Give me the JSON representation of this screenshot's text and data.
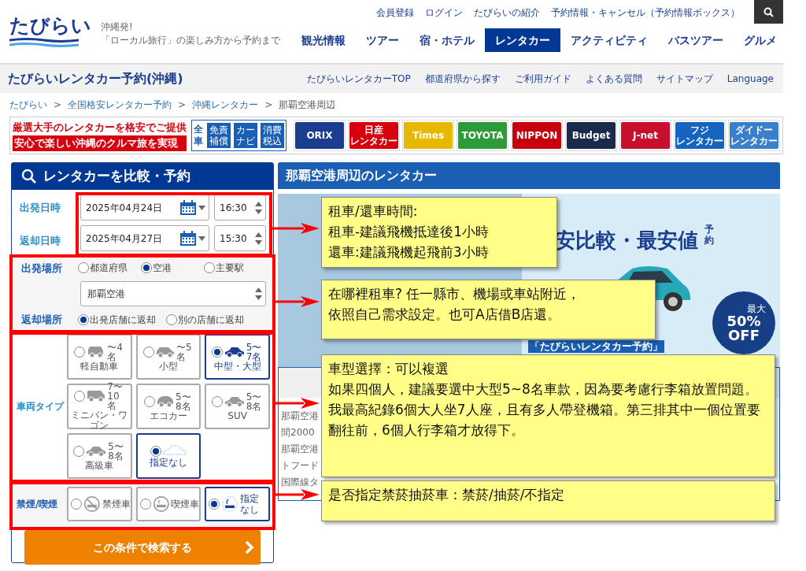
{
  "header": {
    "logo": "たびらい",
    "tagline_1": "沖縄発!",
    "tagline_2": "「ローカル旅行」の楽しみ方から予約まで",
    "top_links": [
      "会員登録",
      "ログイン",
      "たびらいの紹介",
      "予約情報・キャンセル（予約情報ボックス）"
    ],
    "nav": [
      {
        "label": "観光情報",
        "selected": false
      },
      {
        "label": "ツアー",
        "selected": false
      },
      {
        "label": "宿・ホテル",
        "selected": false
      },
      {
        "label": "レンタカー",
        "selected": true
      },
      {
        "label": "アクティビティ",
        "selected": false
      },
      {
        "label": "バスツアー",
        "selected": false
      },
      {
        "label": "グルメ",
        "selected": false
      }
    ]
  },
  "subheader": {
    "title": "たびらいレンタカー予約(沖縄)",
    "links": [
      "たびらいレンタカーTOP",
      "都道府県から探す",
      "ご利用ガイド",
      "よくある質問",
      "サイトマップ",
      "Language"
    ]
  },
  "breadcrumb": {
    "separator": ">",
    "items": [
      "たびらい",
      "全国格安レンタカー予約",
      "沖縄レンタカー",
      "那覇空港周辺"
    ]
  },
  "banner": {
    "line_1": "厳選大手のレンタカーを格安でご提供",
    "line_2": "安心で楽しい沖縄のクルマ旅を実現",
    "all_cars": "全車",
    "features": [
      "免責補償",
      "カーナビ",
      "消費税込"
    ],
    "logos": [
      {
        "lines": [
          "ORIX"
        ],
        "color": "#1a3d8f"
      },
      {
        "lines": [
          "日産",
          "レンタカー"
        ],
        "color": "#d7000f"
      },
      {
        "lines": [
          "Times"
        ],
        "color": "#e6b800"
      },
      {
        "lines": [
          "TOYOTA"
        ],
        "color": "#2e9a3a"
      },
      {
        "lines": [
          "NIPPON"
        ],
        "color": "#c8000d"
      },
      {
        "lines": [
          "Budget"
        ],
        "color": "#1b2a4a"
      },
      {
        "lines": [
          "J-net"
        ],
        "color": "#c8102e"
      },
      {
        "lines": [
          "フジ",
          "レンタカー"
        ],
        "color": "#1565c0"
      },
      {
        "lines": [
          "ダイドー",
          "レンタカー"
        ],
        "color": "#3a7fc9"
      }
    ]
  },
  "search_panel": {
    "title": "レンタカーを比較・予約",
    "pickup": {
      "label": "出発日時",
      "date": "2025年04月24日",
      "time": "16:30"
    },
    "return": {
      "label": "返却日時",
      "date": "2025年04月27日",
      "time": "15:30"
    },
    "departure_place": {
      "label": "出発場所",
      "options": [
        {
          "label": "都道府県",
          "selected": false
        },
        {
          "label": "空港",
          "selected": true
        },
        {
          "label": "主要駅",
          "selected": false
        }
      ],
      "value": "那覇空港"
    },
    "return_place": {
      "label": "返却場所",
      "options": [
        {
          "label": "出発店舗に返却",
          "selected": true
        },
        {
          "label": "別の店舗に返却",
          "selected": false
        }
      ]
    },
    "vehicle": {
      "label": "車両タイプ",
      "options": [
        {
          "kind": "suv",
          "label": "軽自動車",
          "capacity": "〜4名",
          "selected": false
        },
        {
          "kind": "compact",
          "label": "小型",
          "capacity": "〜5名",
          "selected": false
        },
        {
          "kind": "sedan",
          "label": "中型・大型",
          "capacity": "5〜7名",
          "selected": true
        },
        {
          "kind": "van",
          "label": "ミニバン・ワゴン",
          "capacity": "7〜10名",
          "selected": false
        },
        {
          "kind": "eco",
          "label": "エコカー",
          "capacity": "5〜8名",
          "selected": false
        },
        {
          "kind": "sedan",
          "label": "SUV",
          "capacity": "5〜8名",
          "selected": false
        },
        {
          "kind": "sedan",
          "label": "高級車",
          "capacity": "5〜8名",
          "selected": false
        },
        {
          "kind": "any",
          "label": "指定なし",
          "selected": true
        }
      ]
    },
    "smoking": {
      "label": "禁煙/喫煙",
      "options": [
        {
          "kind": "nosmoking",
          "label": "禁煙車",
          "selected": false
        },
        {
          "kind": "smoking",
          "label": "喫煙車",
          "selected": false
        },
        {
          "kind": "any",
          "label": "指定なし",
          "selected": true
        }
      ]
    },
    "search_button": "この条件で検索する"
  },
  "content": {
    "title": "那覇空港周辺のレンタカー",
    "ad": {
      "headline": "安比較・最安値",
      "headline_small": "予約",
      "badge_top": "最大",
      "badge_value": "50%",
      "badge_bottom": "OFF",
      "caption": "「たびらいレンタカー予約」"
    },
    "text_lines": [
      "那覇空港",
      "間2000",
      "那覇空港",
      "トフード",
      "国際線タ"
    ]
  },
  "annotations": [
    {
      "lines": [
        "租車/還車時間:",
        "租車-建議飛機抵達後1小時",
        "還車:建議飛機起飛前3小時"
      ]
    },
    {
      "lines": [
        "在哪裡租車? 任一縣市、機場或車站附近，",
        "依照自己需求設定。也可A店借B店還。"
      ]
    },
    {
      "lines": [
        "車型選擇：可以複選",
        "如果四個人，建議要選中大型5~8名車款，因為要考慮行李箱放置問題。",
        "我最高紀錄6個大人坐7人座，且有多人帶登機箱。第三排其中一個位置要翻往前，6個人行李箱才放得下。"
      ]
    },
    {
      "lines": [
        "是否指定禁菸抽菸車：禁菸/抽菸/不指定"
      ]
    }
  ]
}
